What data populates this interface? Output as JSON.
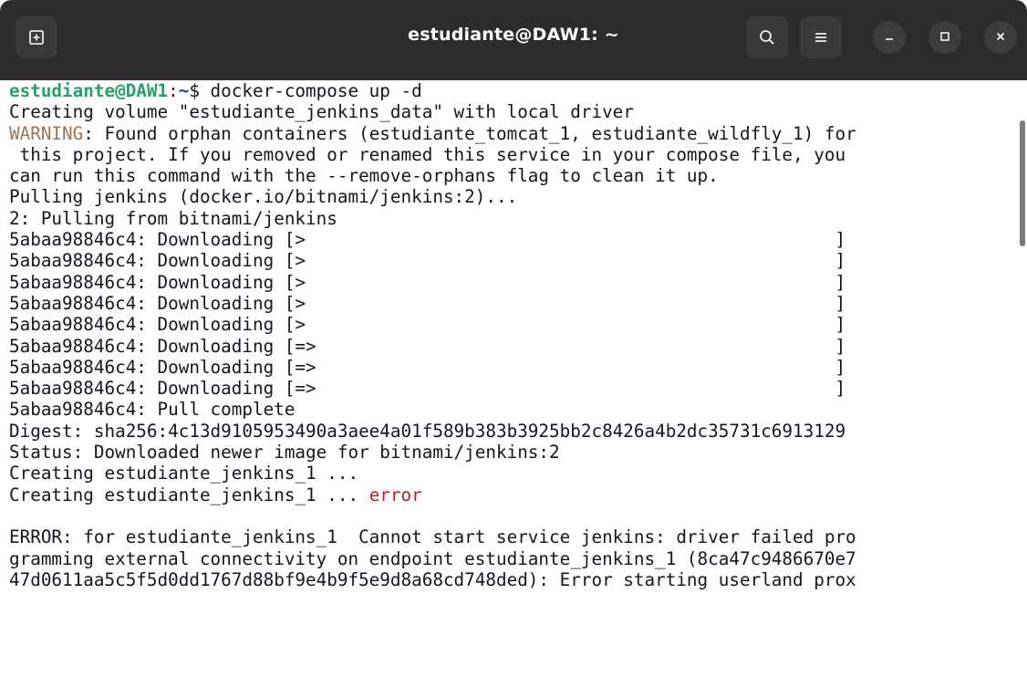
{
  "window": {
    "title": "estudiante@DAW1: ~"
  },
  "terminal": {
    "prompt_user": "estudiante@DAW1",
    "prompt_sep": ":",
    "prompt_path": "~",
    "prompt_symbol": "$",
    "command": " docker-compose up -d",
    "l2": "Creating volume \"estudiante_jenkins_data\" with local driver",
    "warn_label": "WARNING",
    "l3_rest": ": Found orphan containers (estudiante_tomcat_1, estudiante_wildfly_1) for",
    "l4": " this project. If you removed or renamed this service in your compose file, you",
    "l5": "can run this command with the --remove-orphans flag to clean it up.",
    "l6": "Pulling jenkins (docker.io/bitnami/jenkins:2)...",
    "l7": "2: Pulling from bitnami/jenkins",
    "dl1": "5abaa98846c4: Downloading [>                                                  ]",
    "dl2": "5abaa98846c4: Downloading [>                                                  ]",
    "dl3": "5abaa98846c4: Downloading [>                                                  ]",
    "dl4": "5abaa98846c4: Downloading [>                                                  ]",
    "dl5": "5abaa98846c4: Downloading [>                                                  ]",
    "dl6": "5abaa98846c4: Downloading [=>                                                 ]",
    "dl7": "5abaa98846c4: Downloading [=>                                                 ]",
    "dl8": "5abaa98846c4: Downloading [=>                                                 ]",
    "l16": "5abaa98846c4: Pull complete",
    "l17": "Digest: sha256:4c13d9105953490a3aee4a01f589b383b3925bb2c8426a4b2dc35731c6913129",
    "l18": "Status: Downloaded newer image for bitnami/jenkins:2",
    "l19": "Creating estudiante_jenkins_1 ...",
    "l20_prefix": "Creating estudiante_jenkins_1 ... ",
    "l20_error": "error",
    "l21": "",
    "l22": "ERROR: for estudiante_jenkins_1  Cannot start service jenkins: driver failed pro",
    "l23": "gramming external connectivity on endpoint estudiante_jenkins_1 (8ca47c9486670e7",
    "l24": "47d0611aa5c5f5d0dd1767d88bf9e4b9f5e9d8a68cd748ded): Error starting userland prox"
  },
  "icons": {
    "new_tab": "new-tab-icon",
    "search": "search-icon",
    "menu": "hamburger-menu-icon",
    "minimize": "minimize-icon",
    "maximize": "maximize-icon",
    "close": "close-icon"
  },
  "colors": {
    "titlebar": "#2c2c2c",
    "prompt_user": "#26a269",
    "prompt_path": "#12488b",
    "warning": "#a2734c",
    "error": "#c01c28"
  }
}
